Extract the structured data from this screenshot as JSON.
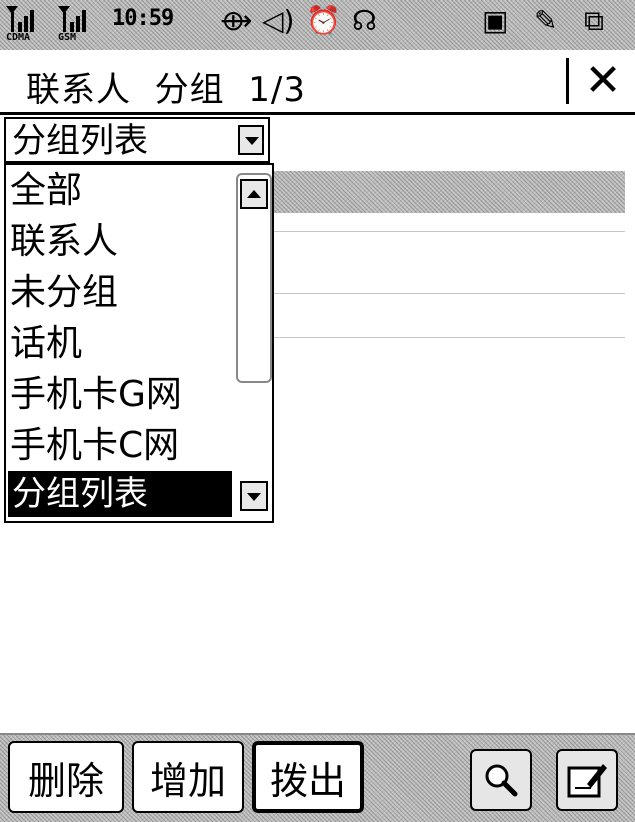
{
  "status_bar": {
    "signal_1_label": "CDMA",
    "signal_2_label": "GSM",
    "time": "10:59",
    "icons": [
      "usb-icon",
      "speaker-icon",
      "alarm-clock-icon",
      "headset-icon",
      "sim-card-icon",
      "edit-icon",
      "windows-icon"
    ]
  },
  "header": {
    "title": "联系人  分组  1/3",
    "close_label": "✕"
  },
  "dropdown": {
    "selected_value": "分组列表",
    "options": [
      "全部",
      "联系人",
      "未分组",
      "话机",
      "手机卡G网",
      "手机卡C网"
    ],
    "highlighted_option": "分组列表"
  },
  "toolbar": {
    "delete_label": "删除",
    "add_label": "增加",
    "dial_label": "拨出",
    "search_icon": "magnifier-icon",
    "edit_icon": "edit-note-icon"
  }
}
